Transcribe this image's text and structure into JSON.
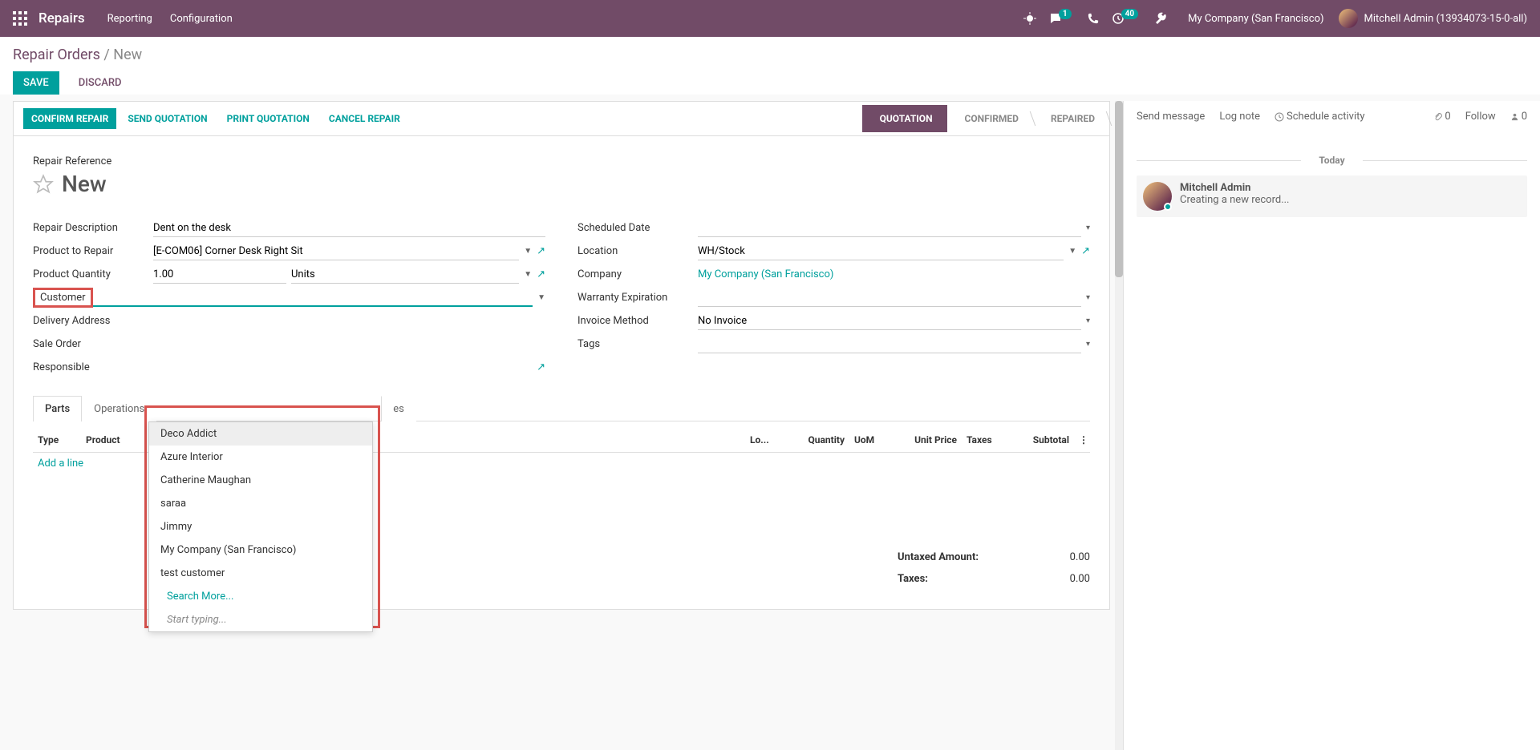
{
  "navbar": {
    "brand": "Repairs",
    "menu": [
      "Reporting",
      "Configuration"
    ],
    "msg_badge": "1",
    "clock_badge": "40",
    "company": "My Company (San Francisco)",
    "user": "Mitchell Admin (13934073-15-0-all)"
  },
  "breadcrumb": {
    "parent": "Repair Orders",
    "current": "New"
  },
  "buttons": {
    "save": "SAVE",
    "discard": "DISCARD"
  },
  "statusbar": {
    "confirm_repair": "CONFIRM REPAIR",
    "send_quotation": "SEND QUOTATION",
    "print_quotation": "PRINT QUOTATION",
    "cancel_repair": "CANCEL REPAIR",
    "stages": [
      "QUOTATION",
      "CONFIRMED",
      "REPAIRED"
    ]
  },
  "form": {
    "ref_label": "Repair Reference",
    "ref_value": "New",
    "left": {
      "repair_description": {
        "label": "Repair Description",
        "value": "Dent on the desk"
      },
      "product_to_repair": {
        "label": "Product to Repair",
        "value": "[E-COM06] Corner Desk Right Sit"
      },
      "product_quantity": {
        "label": "Product Quantity",
        "qty": "1.00",
        "uom": "Units"
      },
      "customer": {
        "label": "Customer",
        "value": ""
      },
      "delivery_address": {
        "label": "Delivery Address",
        "value": ""
      },
      "sale_order": {
        "label": "Sale Order",
        "value": ""
      },
      "responsible": {
        "label": "Responsible",
        "value": ""
      }
    },
    "right": {
      "scheduled_date": {
        "label": "Scheduled Date",
        "value": ""
      },
      "location": {
        "label": "Location",
        "value": "WH/Stock"
      },
      "company": {
        "label": "Company",
        "value": "My Company (San Francisco)"
      },
      "warranty_expiration": {
        "label": "Warranty Expiration",
        "value": ""
      },
      "invoice_method": {
        "label": "Invoice Method",
        "value": "No Invoice"
      },
      "tags": {
        "label": "Tags",
        "value": ""
      }
    }
  },
  "dropdown": {
    "items": [
      "Deco Addict",
      "Azure Interior",
      "Catherine Maughan",
      "saraa",
      "Jimmy",
      "My Company (San Francisco)",
      "test customer"
    ],
    "search_more": "Search More...",
    "start_typing": "Start typing..."
  },
  "tabs": {
    "parts": "Parts",
    "operations": "Operations",
    "notes": "es"
  },
  "table": {
    "headers": {
      "type": "Type",
      "product": "Product",
      "lot": "Lo...",
      "qty": "Quantity",
      "uom": "UoM",
      "price": "Unit Price",
      "taxes": "Taxes",
      "subtotal": "Subtotal"
    },
    "add_line": "Add a line"
  },
  "totals": {
    "untaxed_label": "Untaxed Amount:",
    "untaxed_value": "0.00",
    "taxes_label": "Taxes:",
    "taxes_value": "0.00"
  },
  "chatter": {
    "send": "Send message",
    "log": "Log note",
    "schedule": "Schedule activity",
    "attach_count": "0",
    "follow": "Follow",
    "follower_count": "0",
    "today": "Today",
    "msg_name": "Mitchell Admin",
    "msg_body": "Creating a new record..."
  }
}
